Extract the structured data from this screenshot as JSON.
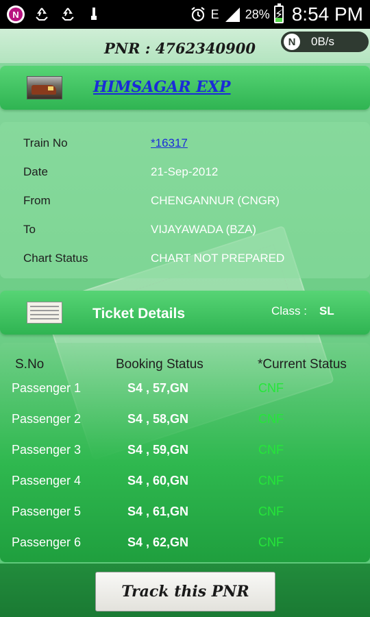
{
  "status_bar": {
    "notification_badge": "N",
    "signal_label": "E",
    "battery": "28%",
    "time": "8:54 PM"
  },
  "header": {
    "pnr": "PNR : 4762340900",
    "net_meter_badge": "N",
    "net_meter_speed": "0B/s"
  },
  "train": {
    "name": "HIMSAGAR EXP"
  },
  "details": [
    {
      "label": "Train No",
      "value": "*16317"
    },
    {
      "label": "Date",
      "value": "21-Sep-2012"
    },
    {
      "label": "From",
      "value": "CHENGANNUR (CNGR)"
    },
    {
      "label": "To",
      "value": "VIJAYAWADA (BZA)"
    },
    {
      "label": "Chart Status",
      "value": "CHART NOT PREPARED"
    }
  ],
  "ticket": {
    "title": "Ticket Details",
    "class_label": "Class :",
    "class_value": "SL"
  },
  "passenger_table": {
    "headers": [
      "S.No",
      "Booking Status",
      "*Current Status"
    ],
    "rows": [
      {
        "name": "Passenger 1",
        "booking": "S4 , 57,GN",
        "current": "CNF"
      },
      {
        "name": "Passenger 2",
        "booking": "S4 , 58,GN",
        "current": "CNF"
      },
      {
        "name": "Passenger 3",
        "booking": "S4 , 59,GN",
        "current": "CNF"
      },
      {
        "name": "Passenger 4",
        "booking": "S4 , 60,GN",
        "current": "CNF"
      },
      {
        "name": "Passenger 5",
        "booking": "S4 , 61,GN",
        "current": "CNF"
      },
      {
        "name": "Passenger 6",
        "booking": "S4 , 62,GN",
        "current": "CNF"
      }
    ]
  },
  "actions": {
    "track_label": "Track this PNR"
  },
  "colors": {
    "accent_green": "#2fb452",
    "link_blue": "#1a2bd8",
    "status_cnf": "#25e63a"
  }
}
